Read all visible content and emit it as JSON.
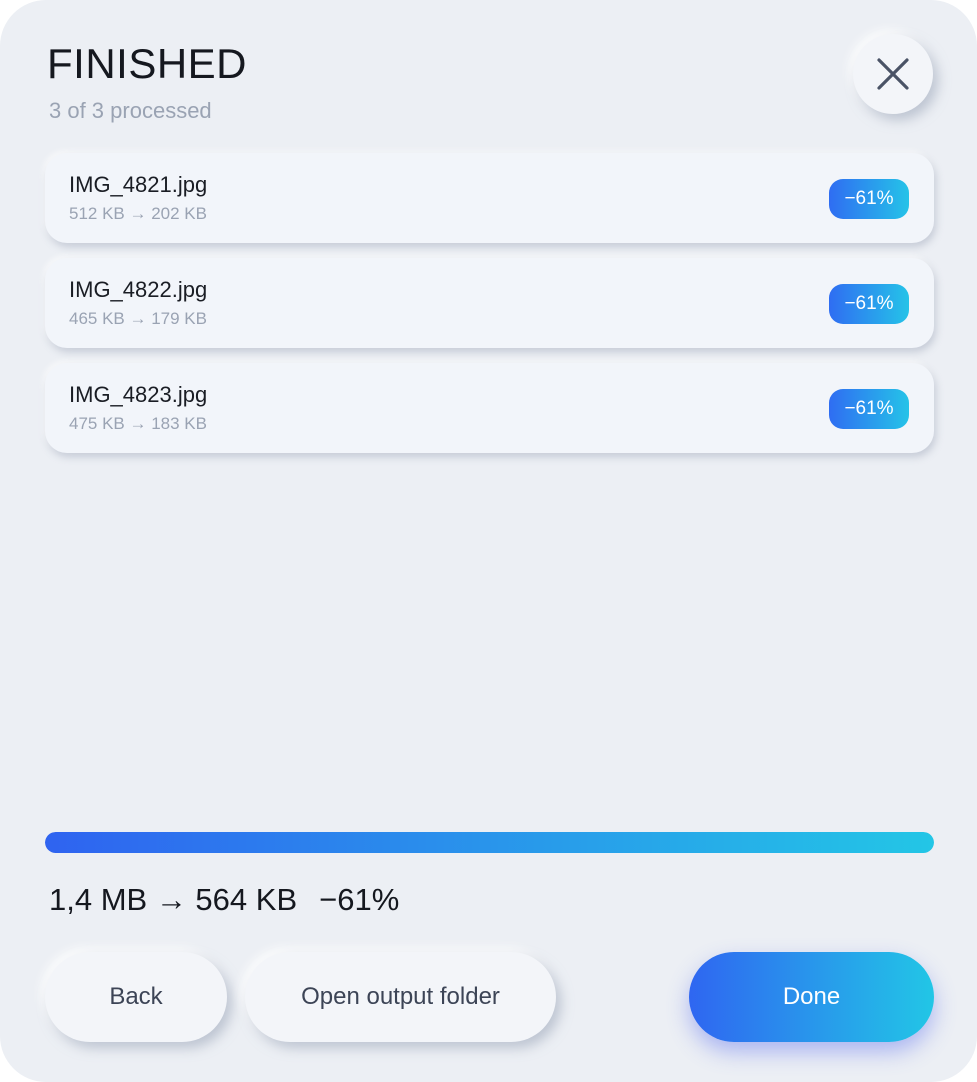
{
  "header": {
    "title": "FINISHED",
    "subtitle": "3 of 3 processed",
    "close_icon": "close-icon"
  },
  "files": [
    {
      "name": "IMG_4821.jpg",
      "sizes": "512 KB → 202 KB",
      "reduction": "−61%"
    },
    {
      "name": "IMG_4822.jpg",
      "sizes": "465 KB → 179 KB",
      "reduction": "−61%"
    },
    {
      "name": "IMG_4823.jpg",
      "sizes": "475 KB → 183 KB",
      "reduction": "−61%"
    }
  ],
  "progress": {
    "percent": 100
  },
  "summary": {
    "sizes": "1,4 MB → 564 KB",
    "reduction": "−61%"
  },
  "buttons": {
    "back": "Back",
    "open_folder": "Open output folder",
    "done": "Done"
  },
  "colors": {
    "accent_start": "#2f66f1",
    "accent_end": "#22c6e6",
    "background": "#eceff4"
  }
}
